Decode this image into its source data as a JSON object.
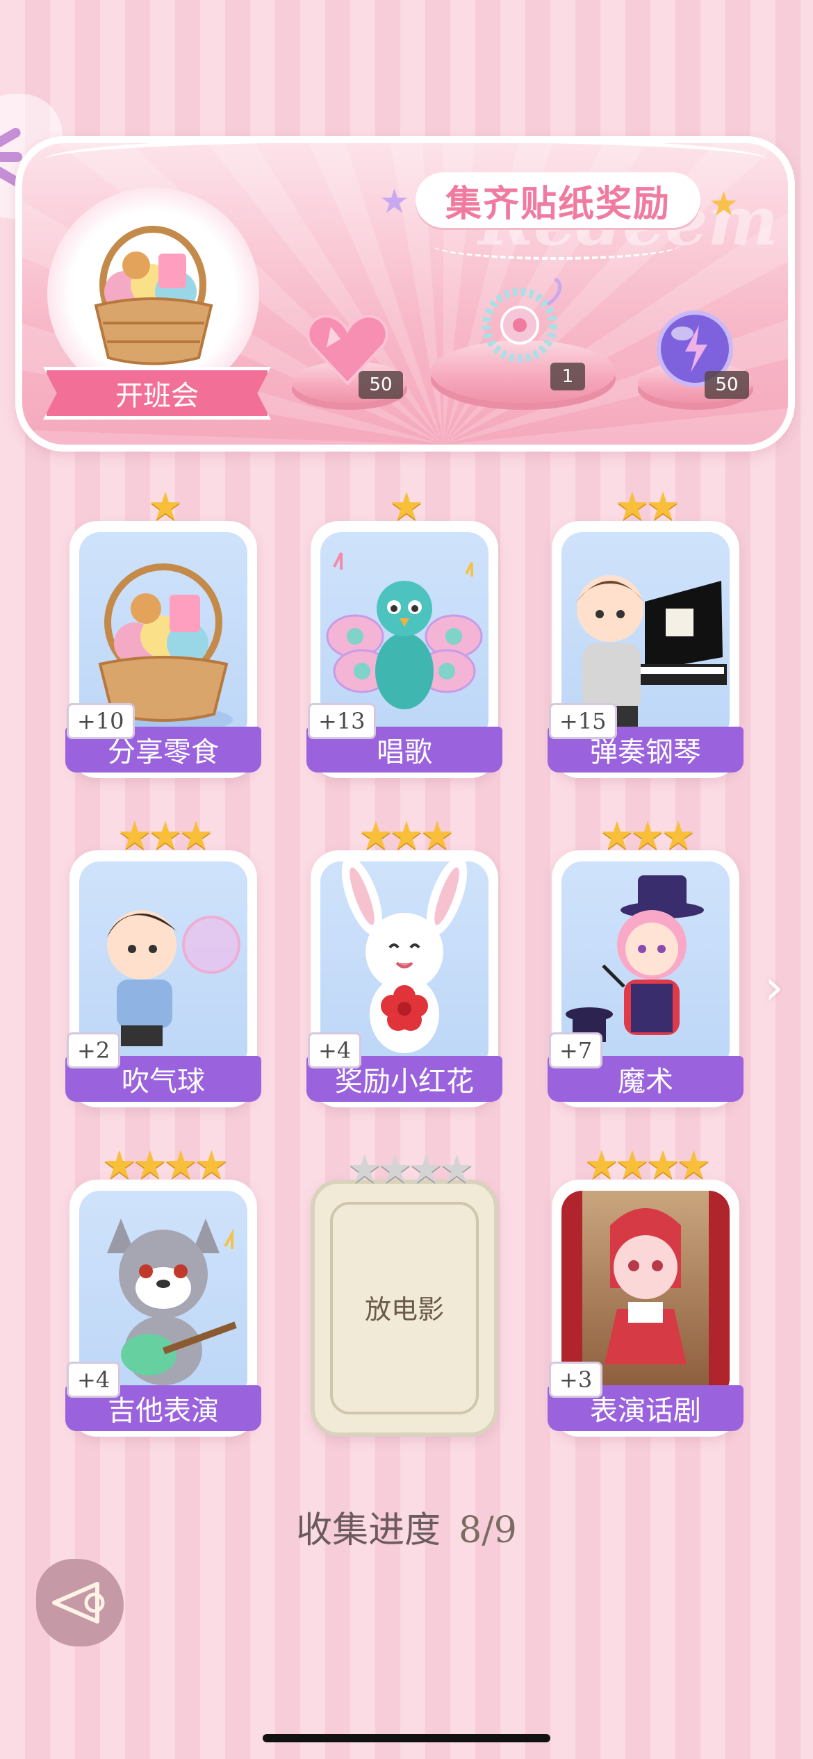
{
  "banner": {
    "title": "集齐贴纸奖励",
    "watermark": "Redeem",
    "main_reward_label": "开班会",
    "rewards": [
      {
        "icon": "pink-heart-gem-icon",
        "count": "50"
      },
      {
        "icon": "gem-bracelet-icon",
        "count": "1"
      },
      {
        "icon": "purple-lightning-orb-icon",
        "count": "50"
      }
    ]
  },
  "cards": [
    {
      "label": "分享零食",
      "bonus": "+10",
      "stars": 1,
      "icon": "snack-basket-icon"
    },
    {
      "label": "唱歌",
      "bonus": "+13",
      "stars": 1,
      "icon": "singing-peacock-icon"
    },
    {
      "label": "弹奏钢琴",
      "bonus": "+15",
      "stars": 2,
      "icon": "boy-piano-icon"
    },
    {
      "label": "吹气球",
      "bonus": "+2",
      "stars": 3,
      "icon": "boy-bubble-icon"
    },
    {
      "label": "奖励小红花",
      "bonus": "+4",
      "stars": 3,
      "icon": "bunny-flower-icon"
    },
    {
      "label": "魔术",
      "bonus": "+7",
      "stars": 3,
      "icon": "magician-girl-icon"
    },
    {
      "label": "吉他表演",
      "bonus": "+4",
      "stars": 4,
      "icon": "wolf-guitar-icon"
    },
    {
      "label": "放电影",
      "bonus": "",
      "stars": 4,
      "locked": true,
      "icon": "locked-card"
    },
    {
      "label": "表演话剧",
      "bonus": "+3",
      "stars": 4,
      "icon": "cat-drama-icon"
    }
  ],
  "progress": {
    "label": "收集进度",
    "value": "8/9"
  },
  "colors": {
    "accent_purple": "#9a63dd",
    "star_gold": "#f7bf3a",
    "banner_pink": "#f27098"
  }
}
